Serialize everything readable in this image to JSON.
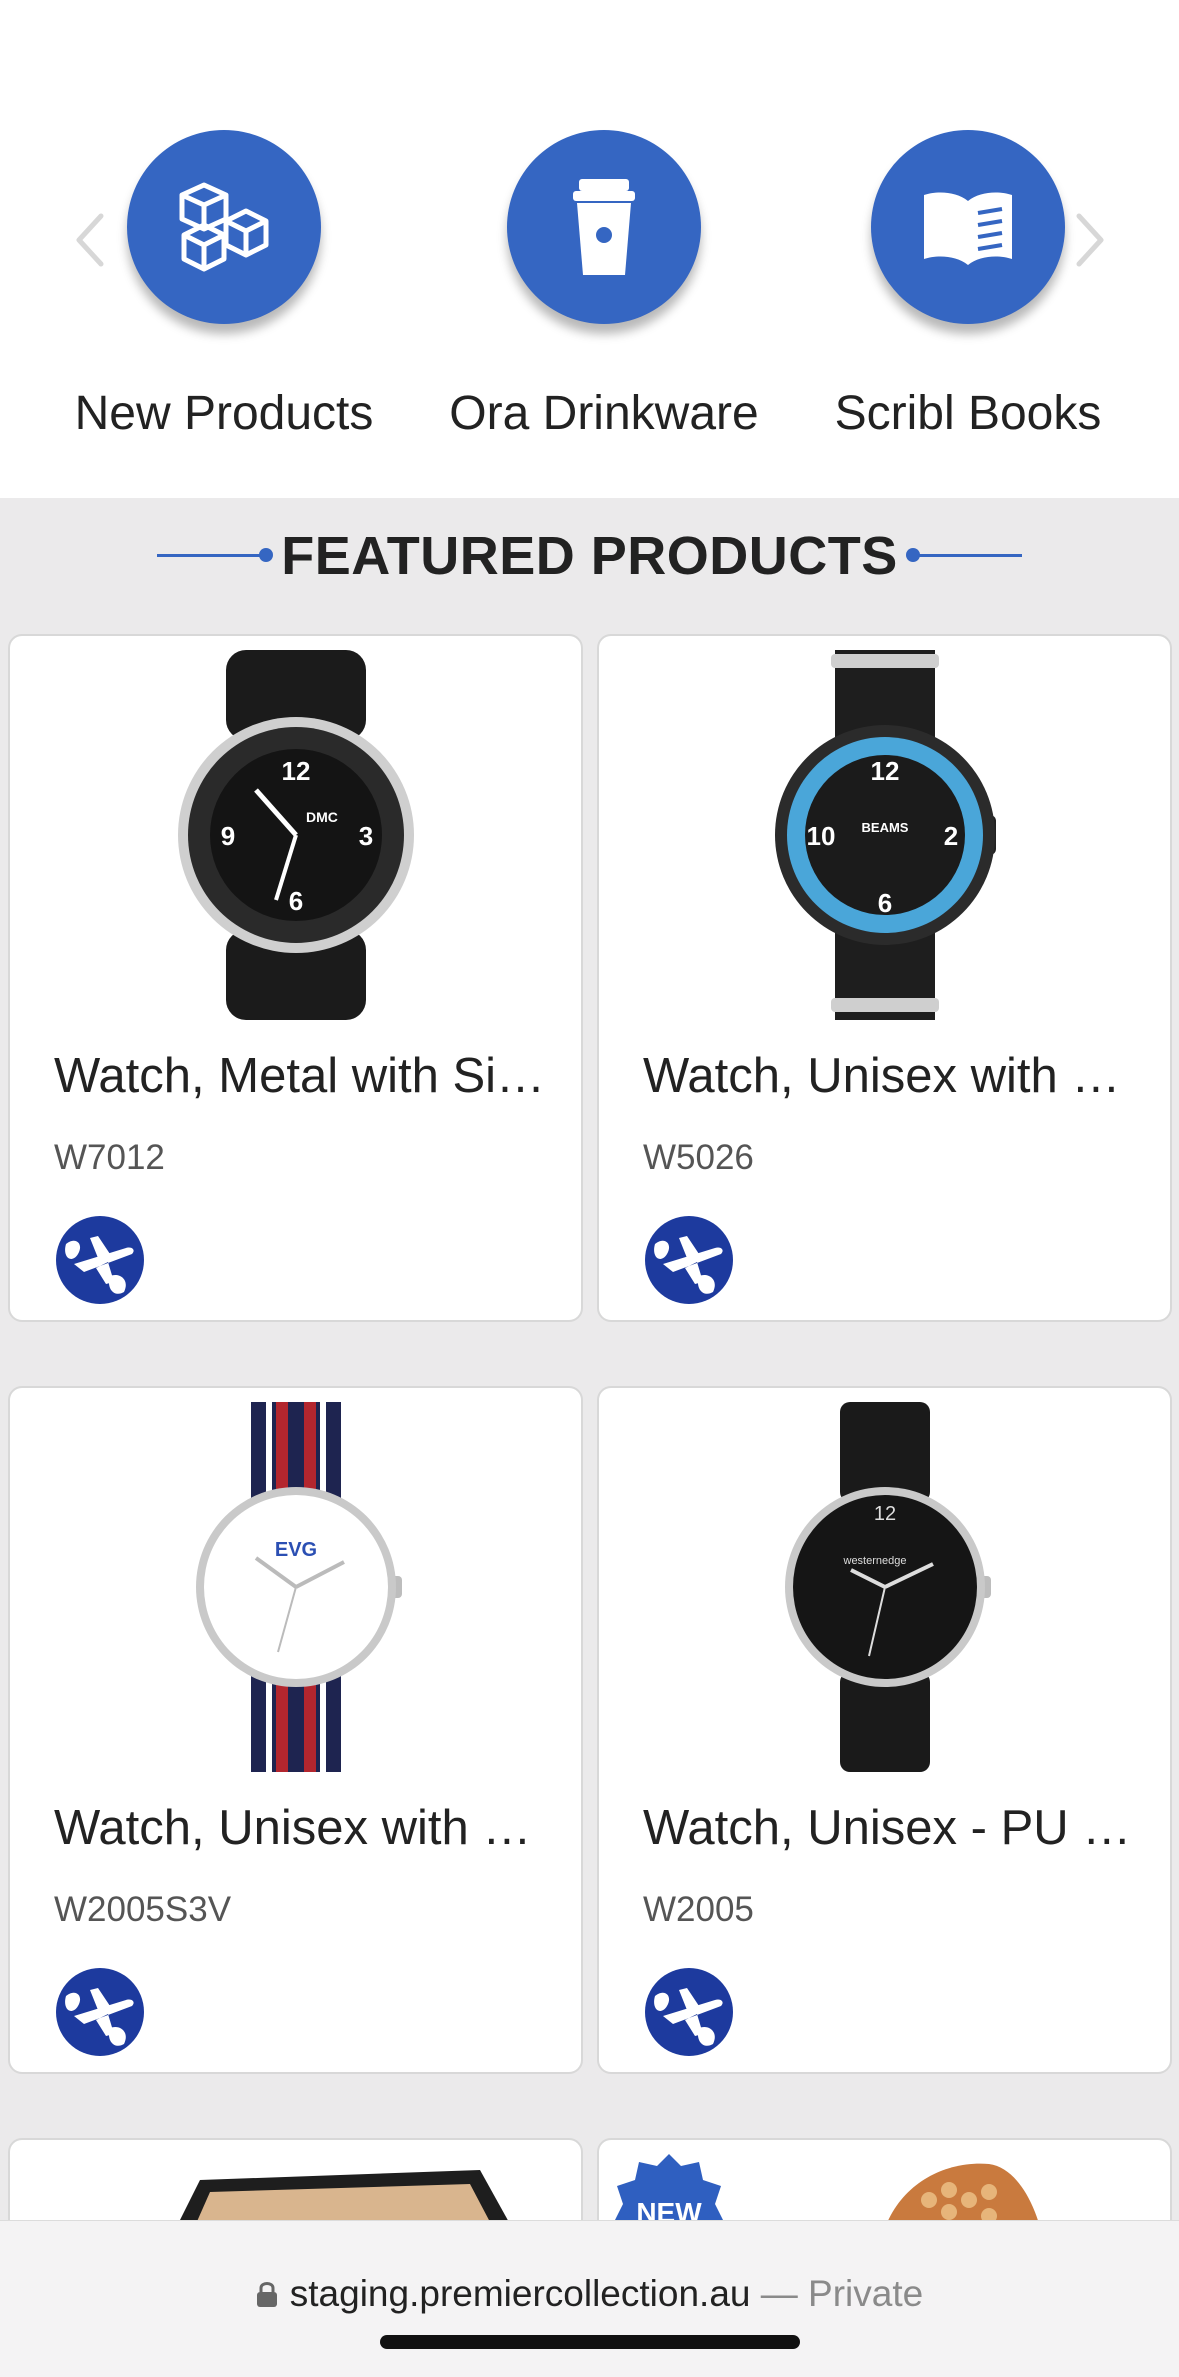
{
  "categories": [
    {
      "label": "New Products",
      "icon": "boxes-icon"
    },
    {
      "label": "Ora Drinkware",
      "icon": "coffee-cup-icon"
    },
    {
      "label": "Scribl Books",
      "icon": "open-book-icon"
    }
  ],
  "featured": {
    "title": "FEATURED PRODUCTS"
  },
  "products": [
    {
      "name": "Watch, Metal with Si…",
      "code": "W7012",
      "brand_on_dial": "DMC"
    },
    {
      "name": "Watch, Unisex with …",
      "code": "W5026",
      "brand_on_dial": "BEAMS"
    },
    {
      "name": "Watch, Unisex with …",
      "code": "W2005S3V",
      "brand_on_dial": "EVG"
    },
    {
      "name": "Watch, Unisex - PU …",
      "code": "W2005",
      "brand_on_dial": "westernedge"
    }
  ],
  "partial": {
    "new_badge": "NEW"
  },
  "browser": {
    "url": "staging.premiercollection.au",
    "private": " — Private"
  },
  "colors": {
    "accent": "#3566c2",
    "ship_badge": "#1d3a9e",
    "page_bg": "#ebeaeb"
  }
}
